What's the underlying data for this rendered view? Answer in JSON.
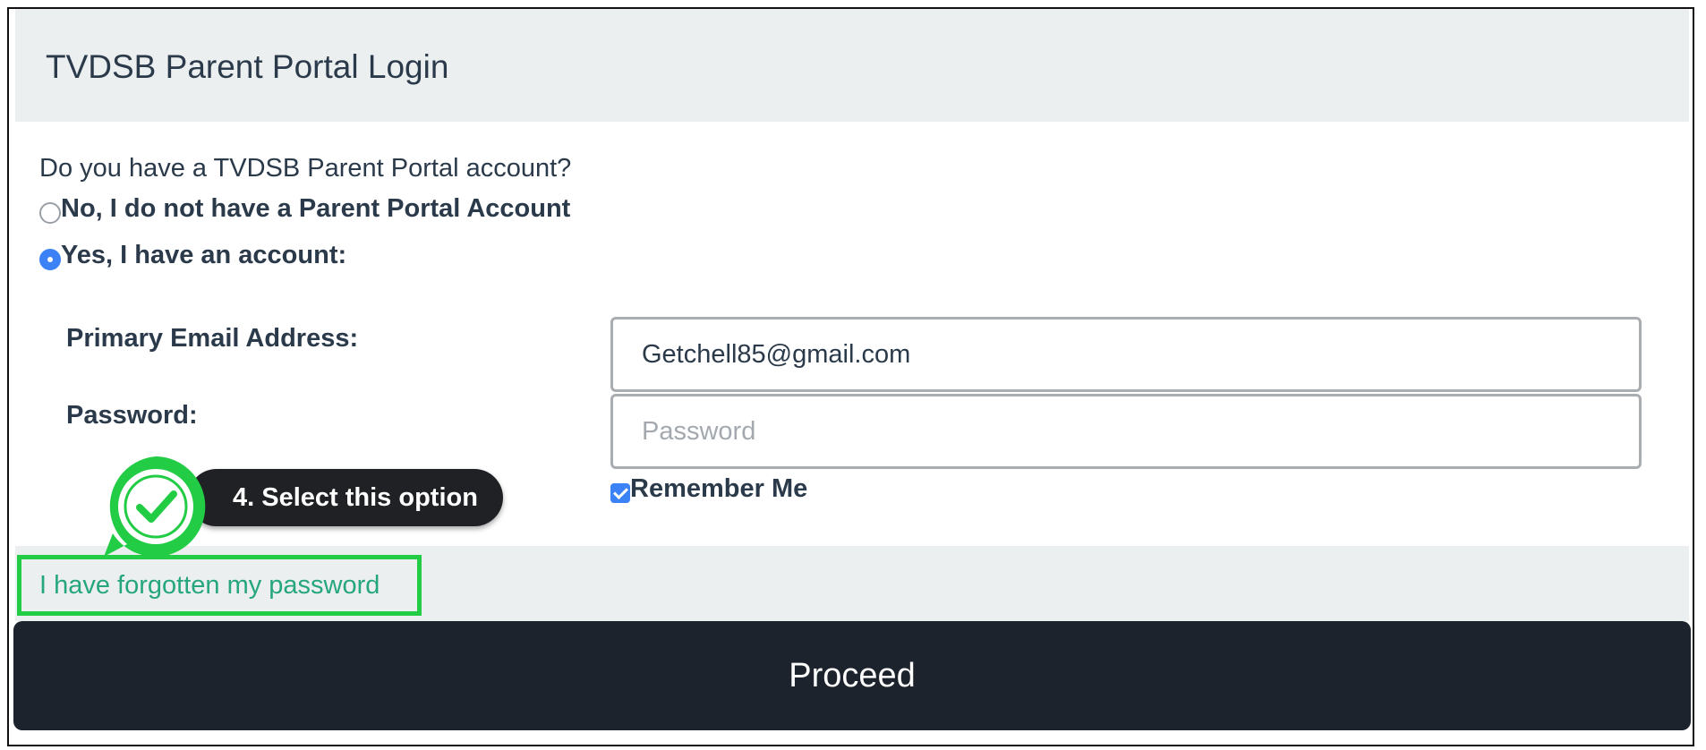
{
  "header": {
    "title": "TVDSB Parent Portal Login"
  },
  "account_question": "Do you have a TVDSB Parent Portal account?",
  "options": {
    "no_label": "No, I do not have a Parent Portal Account",
    "yes_label": "Yes, I have an account:",
    "selected": "yes"
  },
  "form": {
    "email_label": "Primary Email Address:",
    "email_value": "Getchell85@gmail.com",
    "password_label": "Password:",
    "password_placeholder": "Password",
    "remember_label": "Remember Me",
    "remember_checked": true
  },
  "forgot_link": "I have forgotten my password",
  "proceed_label": "Proceed",
  "annotation": {
    "text": "4. Select this option",
    "icon": "checkmark-icon",
    "color": "#22cc44"
  },
  "colors": {
    "accent_blue": "#3b82f6",
    "link_green": "#26a67e",
    "highlight_green": "#22cc44",
    "proceed_bg": "#1c232c",
    "header_bg": "#eceff0"
  }
}
